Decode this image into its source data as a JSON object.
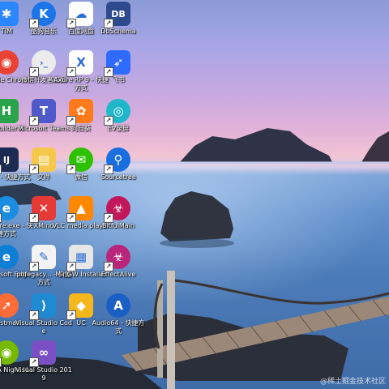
{
  "desktop": {
    "watermark": "@稀土掘金技术社区",
    "icons": [
      {
        "label": "TIM",
        "icon": "tim-icon",
        "color": "#2b86ff",
        "glyph": "✱"
      },
      {
        "label": "酷狗音乐",
        "icon": "kugou-icon",
        "color": "#1c75e8",
        "glyph": "K"
      },
      {
        "label": "百度网盘",
        "icon": "baidu-netdisk-icon",
        "color": "#ffffff",
        "glyph": "☁"
      },
      {
        "label": "DbSchema",
        "icon": "dbschema-icon",
        "color": "#2c4a8c",
        "glyph": "DB"
      },
      {
        "label": "Google Chrome",
        "icon": "chrome-icon",
        "color": "#e94235",
        "glyph": "◉"
      },
      {
        "label": "微信开发者工具",
        "icon": "wechat-devtools-icon",
        "color": "#ececec",
        "glyph": "›_"
      },
      {
        "label": "Axure RP 9 - 快捷方式",
        "icon": "axure-icon",
        "color": "#ffffff",
        "glyph": "X"
      },
      {
        "label": "飞书",
        "icon": "feishu-icon",
        "color": "#2f6bff",
        "glyph": "➶"
      },
      {
        "label": "HBuilder X",
        "icon": "hbuilderx-icon",
        "color": "#2aa34a",
        "glyph": "H"
      },
      {
        "label": "Microsoft Teams",
        "icon": "teams-icon",
        "color": "#5059c9",
        "glyph": "T"
      },
      {
        "label": "向日葵",
        "icon": "sunlogin-icon",
        "color": "#ff7a1a",
        "glyph": "✿"
      },
      {
        "label": "EV录屏",
        "icon": "ev-recorder-icon",
        "color": "#1fb7c9",
        "glyph": "◎"
      },
      {
        "label": "IDEA - 快捷方式",
        "icon": "idea-icon",
        "color": "#1d2b53",
        "glyph": "IJ"
      },
      {
        "label": "文件",
        "icon": "folder-icon",
        "color": "#f5c84b",
        "glyph": "▤"
      },
      {
        "label": "微信",
        "icon": "wechat-icon",
        "color": "#2dc100",
        "glyph": "✉"
      },
      {
        "label": "Sourcetree",
        "icon": "sourcetree-icon",
        "color": "#1a6fe0",
        "glyph": "⚲"
      },
      {
        "label": "iexplore.exe - 快捷方式",
        "icon": "ie-icon",
        "color": "#1c8ce0",
        "glyph": "e"
      },
      {
        "label": "XMind",
        "icon": "xmind-icon",
        "color": "#e53935",
        "glyph": "✕"
      },
      {
        "label": "VLC media player",
        "icon": "vlc-icon",
        "color": "#ff8800",
        "glyph": "▲"
      },
      {
        "label": "BitfuiMain",
        "icon": "bitfui-icon",
        "color": "#c2185b",
        "glyph": "☣"
      },
      {
        "label": "Microsoft Edge",
        "icon": "edge-icon",
        "color": "#0f7fd6",
        "glyph": "e"
      },
      {
        "label": "pdfegacy... - 快捷方式",
        "icon": "pdf-legacy-icon",
        "color": "#f3f3f3",
        "glyph": "✎"
      },
      {
        "label": "MinGW Installer",
        "icon": "mingw-icon",
        "color": "#e6e6e6",
        "glyph": "▦"
      },
      {
        "label": "EffectAlive",
        "icon": "effectalive-icon",
        "color": "#b9257a",
        "glyph": "☣"
      },
      {
        "label": "Postman",
        "icon": "postman-icon",
        "color": "#ff6c37",
        "glyph": "➚"
      },
      {
        "label": "Visual Studio Code",
        "icon": "vscode-icon",
        "color": "#1f8ad2",
        "glyph": "⟩"
      },
      {
        "label": "UC",
        "icon": "uc-icon",
        "color": "#f5b81c",
        "glyph": "◆"
      },
      {
        "label": "Audio64 - 快捷方式",
        "icon": "audio64-icon",
        "color": "#1c5fc4",
        "glyph": "A"
      },
      {
        "label": "NVIDIA Night H...",
        "icon": "nvidia-icon",
        "color": "#76b900",
        "glyph": "◉"
      },
      {
        "label": "Visual Studio 2019",
        "icon": "visual-studio-icon",
        "color": "#7b4fc4",
        "glyph": "∞"
      }
    ]
  }
}
